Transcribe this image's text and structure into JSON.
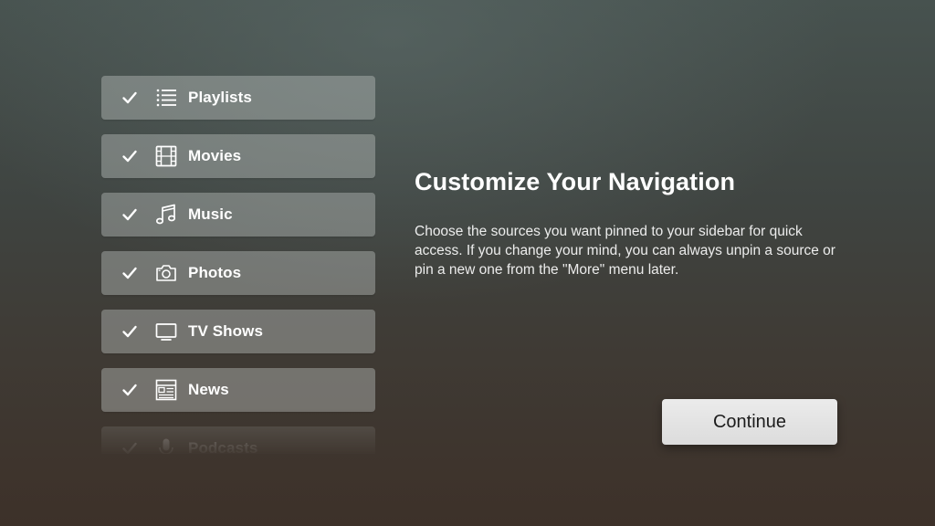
{
  "sources": [
    {
      "label": "Playlists",
      "icon": "list-icon",
      "checked": true
    },
    {
      "label": "Movies",
      "icon": "film-icon",
      "checked": true
    },
    {
      "label": "Music",
      "icon": "music-note-icon",
      "checked": true
    },
    {
      "label": "Photos",
      "icon": "camera-icon",
      "checked": true
    },
    {
      "label": "TV Shows",
      "icon": "tv-icon",
      "checked": true
    },
    {
      "label": "News",
      "icon": "newspaper-icon",
      "checked": true
    },
    {
      "label": "Podcasts",
      "icon": "microphone-icon",
      "checked": true
    }
  ],
  "panel": {
    "title": "Customize Your Navigation",
    "description": "Choose the sources you want pinned to your sidebar for quick access. If you change your mind, you can always unpin a source or pin a new one from the \"More\" menu later."
  },
  "continue_label": "Continue"
}
